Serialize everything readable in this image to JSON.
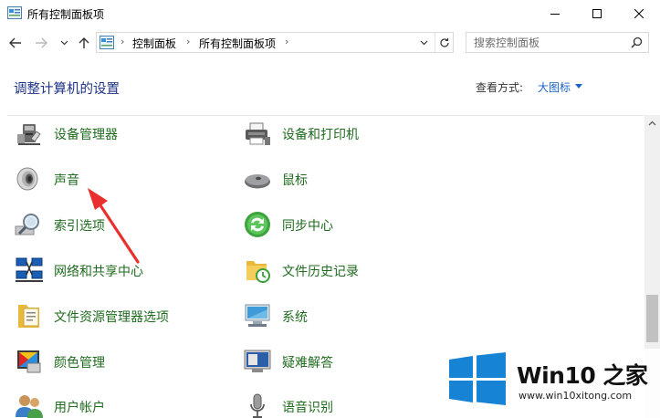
{
  "window": {
    "title": "所有控制面板项",
    "minimize_icon": "minimize-icon",
    "maximize_icon": "maximize-icon",
    "close_icon": "close-icon"
  },
  "nav": {
    "back_icon": "back-arrow-icon",
    "forward_icon": "forward-arrow-icon",
    "history_icon": "chevron-down-icon",
    "up_icon": "up-arrow-icon"
  },
  "address": {
    "crumbs": [
      "控制面板",
      "所有控制面板项"
    ],
    "separator": "›"
  },
  "search": {
    "placeholder": "搜索控制面板"
  },
  "header": {
    "title": "调整计算机的设置",
    "view_by_label": "查看方式:",
    "view_by_value": "大图标"
  },
  "items": [
    {
      "label": "设备管理器",
      "icon": "device-manager-icon"
    },
    {
      "label": "设备和打印机",
      "icon": "printer-icon"
    },
    {
      "label": "声音",
      "icon": "speaker-icon"
    },
    {
      "label": "鼠标",
      "icon": "mouse-icon"
    },
    {
      "label": "索引选项",
      "icon": "indexing-icon"
    },
    {
      "label": "同步中心",
      "icon": "sync-icon"
    },
    {
      "label": "网络和共享中心",
      "icon": "network-icon"
    },
    {
      "label": "文件历史记录",
      "icon": "file-history-icon"
    },
    {
      "label": "文件资源管理器选项",
      "icon": "folder-options-icon"
    },
    {
      "label": "系统",
      "icon": "system-icon"
    },
    {
      "label": "颜色管理",
      "icon": "color-management-icon"
    },
    {
      "label": "疑难解答",
      "icon": "troubleshooting-icon"
    },
    {
      "label": "用户帐户",
      "icon": "user-accounts-icon"
    },
    {
      "label": "语音识别",
      "icon": "microphone-icon"
    }
  ],
  "colors": {
    "link_green": "#1f6b1f",
    "title_blue": "#1e3287",
    "view_blue": "#1a63c6",
    "annotation_red": "#e8312f",
    "win_blue": "#1783d4"
  },
  "watermark": {
    "title": "Win10 之家",
    "site": "www.win10xitong.com"
  }
}
